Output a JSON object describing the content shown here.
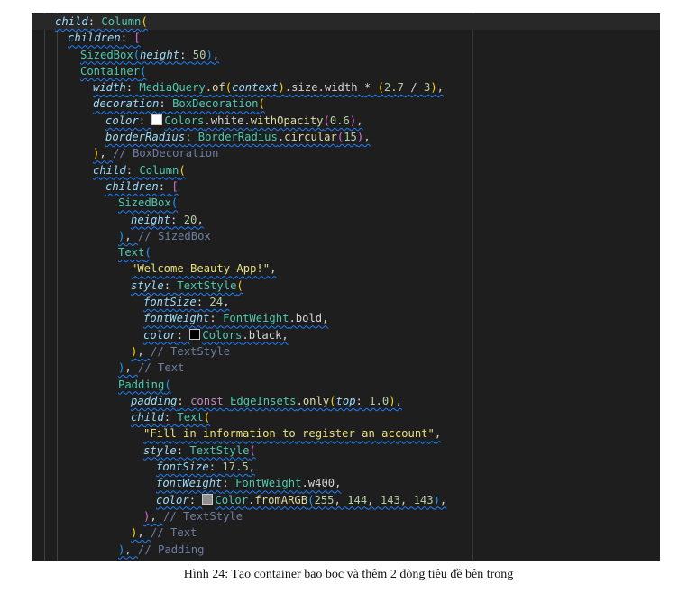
{
  "editor": {
    "lines": [
      {
        "indent": 1,
        "active": true,
        "tokens": [
          [
            "k",
            "child"
          ],
          [
            "p",
            ": "
          ],
          [
            "cl",
            "Column"
          ],
          [
            "y",
            "("
          ]
        ]
      },
      {
        "indent": 2,
        "tokens": [
          [
            "k",
            "children"
          ],
          [
            "p",
            ": "
          ],
          [
            "m",
            "["
          ]
        ]
      },
      {
        "indent": 3,
        "tokens": [
          [
            "cl",
            "SizedBox"
          ],
          [
            "b",
            "("
          ],
          [
            "k",
            "height"
          ],
          [
            "p",
            ": "
          ],
          [
            "n",
            "50"
          ],
          [
            "b",
            ")"
          ],
          [
            "p",
            ","
          ]
        ]
      },
      {
        "indent": 3,
        "tokens": [
          [
            "cl",
            "Container"
          ],
          [
            "b",
            "("
          ]
        ]
      },
      {
        "indent": 4,
        "tokens": [
          [
            "k",
            "width"
          ],
          [
            "p",
            ": "
          ],
          [
            "cl",
            "MediaQuery"
          ],
          [
            "p",
            "."
          ],
          [
            "f",
            "of"
          ],
          [
            "y",
            "("
          ],
          [
            "k",
            "context"
          ],
          [
            "y",
            ")"
          ],
          [
            "p",
            ".size.width "
          ],
          [
            "p",
            "* "
          ],
          [
            "y",
            "("
          ],
          [
            "n",
            "2.7"
          ],
          [
            "p",
            " / "
          ],
          [
            "n",
            "3"
          ],
          [
            "y",
            ")"
          ],
          [
            "p",
            ","
          ]
        ]
      },
      {
        "indent": 4,
        "tokens": [
          [
            "k",
            "decoration"
          ],
          [
            "p",
            ": "
          ],
          [
            "cl",
            "BoxDecoration"
          ],
          [
            "y",
            "("
          ]
        ]
      },
      {
        "indent": 5,
        "tokens": [
          [
            "k",
            "color"
          ],
          [
            "p",
            ": "
          ],
          [
            "sw",
            "#ffffff"
          ],
          [
            "cl",
            "Colors"
          ],
          [
            "p",
            ".white."
          ],
          [
            "f",
            "withOpacity"
          ],
          [
            "m",
            "("
          ],
          [
            "n",
            "0.6"
          ],
          [
            "m",
            ")"
          ],
          [
            "p",
            ","
          ]
        ]
      },
      {
        "indent": 5,
        "tokens": [
          [
            "k",
            "borderRadius"
          ],
          [
            "p",
            ": "
          ],
          [
            "cl",
            "BorderRadius"
          ],
          [
            "p",
            "."
          ],
          [
            "f",
            "circular"
          ],
          [
            "m",
            "("
          ],
          [
            "n",
            "15"
          ],
          [
            "m",
            ")"
          ],
          [
            "p",
            ","
          ]
        ]
      },
      {
        "indent": 4,
        "tokens": [
          [
            "y",
            ")"
          ],
          [
            "p",
            ", "
          ],
          [
            "c",
            "// BoxDecoration"
          ]
        ]
      },
      {
        "indent": 4,
        "tokens": [
          [
            "k",
            "child"
          ],
          [
            "p",
            ": "
          ],
          [
            "cl",
            "Column"
          ],
          [
            "y",
            "("
          ]
        ]
      },
      {
        "indent": 5,
        "tokens": [
          [
            "k",
            "children"
          ],
          [
            "p",
            ": "
          ],
          [
            "m",
            "["
          ]
        ]
      },
      {
        "indent": 6,
        "tokens": [
          [
            "cl",
            "SizedBox"
          ],
          [
            "b",
            "("
          ]
        ]
      },
      {
        "indent": 7,
        "tokens": [
          [
            "k",
            "height"
          ],
          [
            "p",
            ": "
          ],
          [
            "n",
            "20"
          ],
          [
            "p",
            ","
          ]
        ]
      },
      {
        "indent": 6,
        "tokens": [
          [
            "b",
            ")"
          ],
          [
            "p",
            ", "
          ],
          [
            "c",
            "// SizedBox"
          ]
        ]
      },
      {
        "indent": 6,
        "tokens": [
          [
            "cl",
            "Text"
          ],
          [
            "b",
            "("
          ]
        ]
      },
      {
        "indent": 7,
        "tokens": [
          [
            "s",
            "\"Welcome Beauty App!\""
          ],
          [
            "p",
            ","
          ]
        ]
      },
      {
        "indent": 7,
        "tokens": [
          [
            "k",
            "style"
          ],
          [
            "p",
            ": "
          ],
          [
            "cl",
            "TextStyle"
          ],
          [
            "y",
            "("
          ]
        ]
      },
      {
        "indent": 8,
        "tokens": [
          [
            "k",
            "fontSize"
          ],
          [
            "p",
            ": "
          ],
          [
            "n",
            "24"
          ],
          [
            "p",
            ","
          ]
        ]
      },
      {
        "indent": 8,
        "tokens": [
          [
            "k",
            "fontWeight"
          ],
          [
            "p",
            ": "
          ],
          [
            "cl",
            "FontWeight"
          ],
          [
            "p",
            ".bold,"
          ]
        ]
      },
      {
        "indent": 8,
        "tokens": [
          [
            "k",
            "color"
          ],
          [
            "p",
            ": "
          ],
          [
            "sw",
            "#000000"
          ],
          [
            "cl",
            "Colors"
          ],
          [
            "p",
            ".black,"
          ]
        ]
      },
      {
        "indent": 7,
        "tokens": [
          [
            "y",
            ")"
          ],
          [
            "p",
            ", "
          ],
          [
            "c",
            "// TextStyle"
          ]
        ]
      },
      {
        "indent": 6,
        "tokens": [
          [
            "b",
            ")"
          ],
          [
            "p",
            ", "
          ],
          [
            "c",
            "// Text"
          ]
        ]
      },
      {
        "indent": 6,
        "tokens": [
          [
            "cl",
            "Padding"
          ],
          [
            "b",
            "("
          ]
        ]
      },
      {
        "indent": 7,
        "tokens": [
          [
            "k",
            "padding"
          ],
          [
            "p",
            ": "
          ],
          [
            "kw",
            "const "
          ],
          [
            "cl",
            "EdgeInsets"
          ],
          [
            "p",
            "."
          ],
          [
            "f",
            "only"
          ],
          [
            "y",
            "("
          ],
          [
            "k",
            "top"
          ],
          [
            "p",
            ": "
          ],
          [
            "n",
            "1.0"
          ],
          [
            "y",
            ")"
          ],
          [
            "p",
            ","
          ]
        ]
      },
      {
        "indent": 7,
        "tokens": [
          [
            "k",
            "child"
          ],
          [
            "p",
            ": "
          ],
          [
            "cl",
            "Text"
          ],
          [
            "y",
            "("
          ]
        ]
      },
      {
        "indent": 8,
        "tokens": [
          [
            "s",
            "\"Fill in information to register an account\""
          ],
          [
            "p",
            ","
          ]
        ]
      },
      {
        "indent": 8,
        "tokens": [
          [
            "k",
            "style"
          ],
          [
            "p",
            ": "
          ],
          [
            "cl",
            "TextStyle"
          ],
          [
            "m",
            "("
          ]
        ]
      },
      {
        "indent": 9,
        "tokens": [
          [
            "k",
            "fontSize"
          ],
          [
            "p",
            ": "
          ],
          [
            "n",
            "17.5"
          ],
          [
            "p",
            ","
          ]
        ]
      },
      {
        "indent": 9,
        "tokens": [
          [
            "k",
            "fontWeight"
          ],
          [
            "p",
            ": "
          ],
          [
            "cl",
            "FontWeight"
          ],
          [
            "p",
            ".w400,"
          ]
        ]
      },
      {
        "indent": 9,
        "tokens": [
          [
            "k",
            "color"
          ],
          [
            "p",
            ": "
          ],
          [
            "sw",
            "#909090"
          ],
          [
            "cl",
            "Color"
          ],
          [
            "p",
            "."
          ],
          [
            "f",
            "fromARGB"
          ],
          [
            "b",
            "("
          ],
          [
            "n",
            "255"
          ],
          [
            "p",
            ", "
          ],
          [
            "n",
            "144"
          ],
          [
            "p",
            ", "
          ],
          [
            "n",
            "143"
          ],
          [
            "p",
            ", "
          ],
          [
            "n",
            "143"
          ],
          [
            "b",
            ")"
          ],
          [
            "p",
            ","
          ]
        ]
      },
      {
        "indent": 8,
        "tokens": [
          [
            "m",
            ")"
          ],
          [
            "p",
            ", "
          ],
          [
            "c",
            "// TextStyle"
          ]
        ]
      },
      {
        "indent": 7,
        "tokens": [
          [
            "y",
            ")"
          ],
          [
            "p",
            ", "
          ],
          [
            "c",
            "// Text"
          ]
        ]
      },
      {
        "indent": 6,
        "tokens": [
          [
            "b",
            ")"
          ],
          [
            "p",
            ", "
          ],
          [
            "c",
            "// Padding"
          ]
        ]
      }
    ]
  },
  "caption": "Hình 24: Tạo container bao bọc và thêm 2 dòng tiêu đề bên trong"
}
